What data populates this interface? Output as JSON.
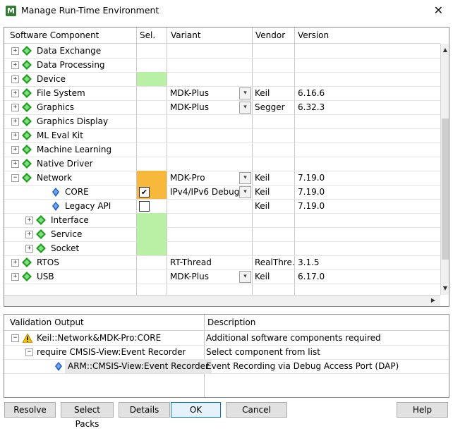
{
  "window": {
    "title": "Manage Run-Time Environment",
    "close_label": "✕"
  },
  "columns": {
    "component": "Software Component",
    "sel": "Sel.",
    "variant": "Variant",
    "vendor": "Vendor",
    "version": "Version"
  },
  "components": [
    {
      "name": "Data Exchange",
      "expander": "+",
      "indent": 0,
      "icon": "gem",
      "sel": "",
      "variant": "",
      "dropdown": false,
      "vendor": "",
      "version": ""
    },
    {
      "name": "Data Processing",
      "expander": "+",
      "indent": 0,
      "icon": "gem",
      "sel": "",
      "variant": "",
      "dropdown": false,
      "vendor": "",
      "version": ""
    },
    {
      "name": "Device",
      "expander": "+",
      "indent": 0,
      "icon": "gem",
      "sel": "green",
      "variant": "",
      "dropdown": false,
      "vendor": "",
      "version": ""
    },
    {
      "name": "File System",
      "expander": "+",
      "indent": 0,
      "icon": "gem",
      "sel": "",
      "variant": "MDK-Plus",
      "dropdown": true,
      "vendor": "Keil",
      "version": "6.16.6"
    },
    {
      "name": "Graphics",
      "expander": "+",
      "indent": 0,
      "icon": "gem",
      "sel": "",
      "variant": "MDK-Plus",
      "dropdown": true,
      "vendor": "Segger",
      "version": "6.32.3"
    },
    {
      "name": "Graphics Display",
      "expander": "+",
      "indent": 0,
      "icon": "gem",
      "sel": "",
      "variant": "",
      "dropdown": false,
      "vendor": "",
      "version": ""
    },
    {
      "name": "ML Eval Kit",
      "expander": "+",
      "indent": 0,
      "icon": "gem",
      "sel": "",
      "variant": "",
      "dropdown": false,
      "vendor": "",
      "version": ""
    },
    {
      "name": "Machine Learning",
      "expander": "+",
      "indent": 0,
      "icon": "gem",
      "sel": "",
      "variant": "",
      "dropdown": false,
      "vendor": "",
      "version": ""
    },
    {
      "name": "Native Driver",
      "expander": "+",
      "indent": 0,
      "icon": "gem",
      "sel": "",
      "variant": "",
      "dropdown": false,
      "vendor": "",
      "version": ""
    },
    {
      "name": "Network",
      "expander": "−",
      "indent": 0,
      "icon": "gem",
      "sel": "orange",
      "variant": "MDK-Pro",
      "dropdown": true,
      "vendor": "Keil",
      "version": "7.19.0"
    },
    {
      "name": "CORE",
      "expander": "",
      "indent": 1,
      "icon": "diamond",
      "sel": "checked-orange",
      "variant": "IPv4/IPv6 Debug",
      "dropdown": true,
      "vendor": "Keil",
      "version": "7.19.0"
    },
    {
      "name": "Legacy API",
      "expander": "",
      "indent": 1,
      "icon": "diamond",
      "sel": "unchecked",
      "variant": "",
      "dropdown": false,
      "vendor": "Keil",
      "version": "7.19.0"
    },
    {
      "name": "Interface",
      "expander": "+",
      "indent": 1,
      "icon": "gem",
      "sel": "green",
      "variant": "",
      "dropdown": false,
      "vendor": "",
      "version": ""
    },
    {
      "name": "Service",
      "expander": "+",
      "indent": 1,
      "icon": "gem",
      "sel": "green",
      "variant": "",
      "dropdown": false,
      "vendor": "",
      "version": ""
    },
    {
      "name": "Socket",
      "expander": "+",
      "indent": 1,
      "icon": "gem",
      "sel": "green",
      "variant": "",
      "dropdown": false,
      "vendor": "",
      "version": ""
    },
    {
      "name": "RTOS",
      "expander": "+",
      "indent": 0,
      "icon": "gem",
      "sel": "",
      "variant": "RT-Thread",
      "dropdown": false,
      "vendor": "RealThre…",
      "version": "3.1.5"
    },
    {
      "name": "USB",
      "expander": "+",
      "indent": 0,
      "icon": "gem",
      "sel": "",
      "variant": "MDK-Plus",
      "dropdown": true,
      "vendor": "Keil",
      "version": "6.17.0"
    }
  ],
  "validation": {
    "col_output": "Validation Output",
    "col_description": "Description",
    "rows": [
      {
        "text": "Keil::Network&MDK-Pro:CORE",
        "description": "Additional software components required",
        "icon": "warning"
      },
      {
        "text": "require CMSIS-View:Event Recorder",
        "description": "Select component from list",
        "icon": "none"
      },
      {
        "text": "ARM::CMSIS-View:Event Recorder",
        "description": "Event Recording via Debug Access Port (DAP)",
        "icon": "diamond"
      }
    ]
  },
  "buttons": {
    "resolve": "Resolve",
    "select_packs": "Select Packs",
    "details": "Details",
    "ok": "OK",
    "cancel": "Cancel",
    "help": "Help"
  },
  "colors": {
    "sel_green": "#b9f0a6",
    "sel_orange": "#f6b93b",
    "gem_green": "#1e9e1e",
    "diamond_blue": "#1f5fd6",
    "warning_yellow": "#f5c400"
  }
}
